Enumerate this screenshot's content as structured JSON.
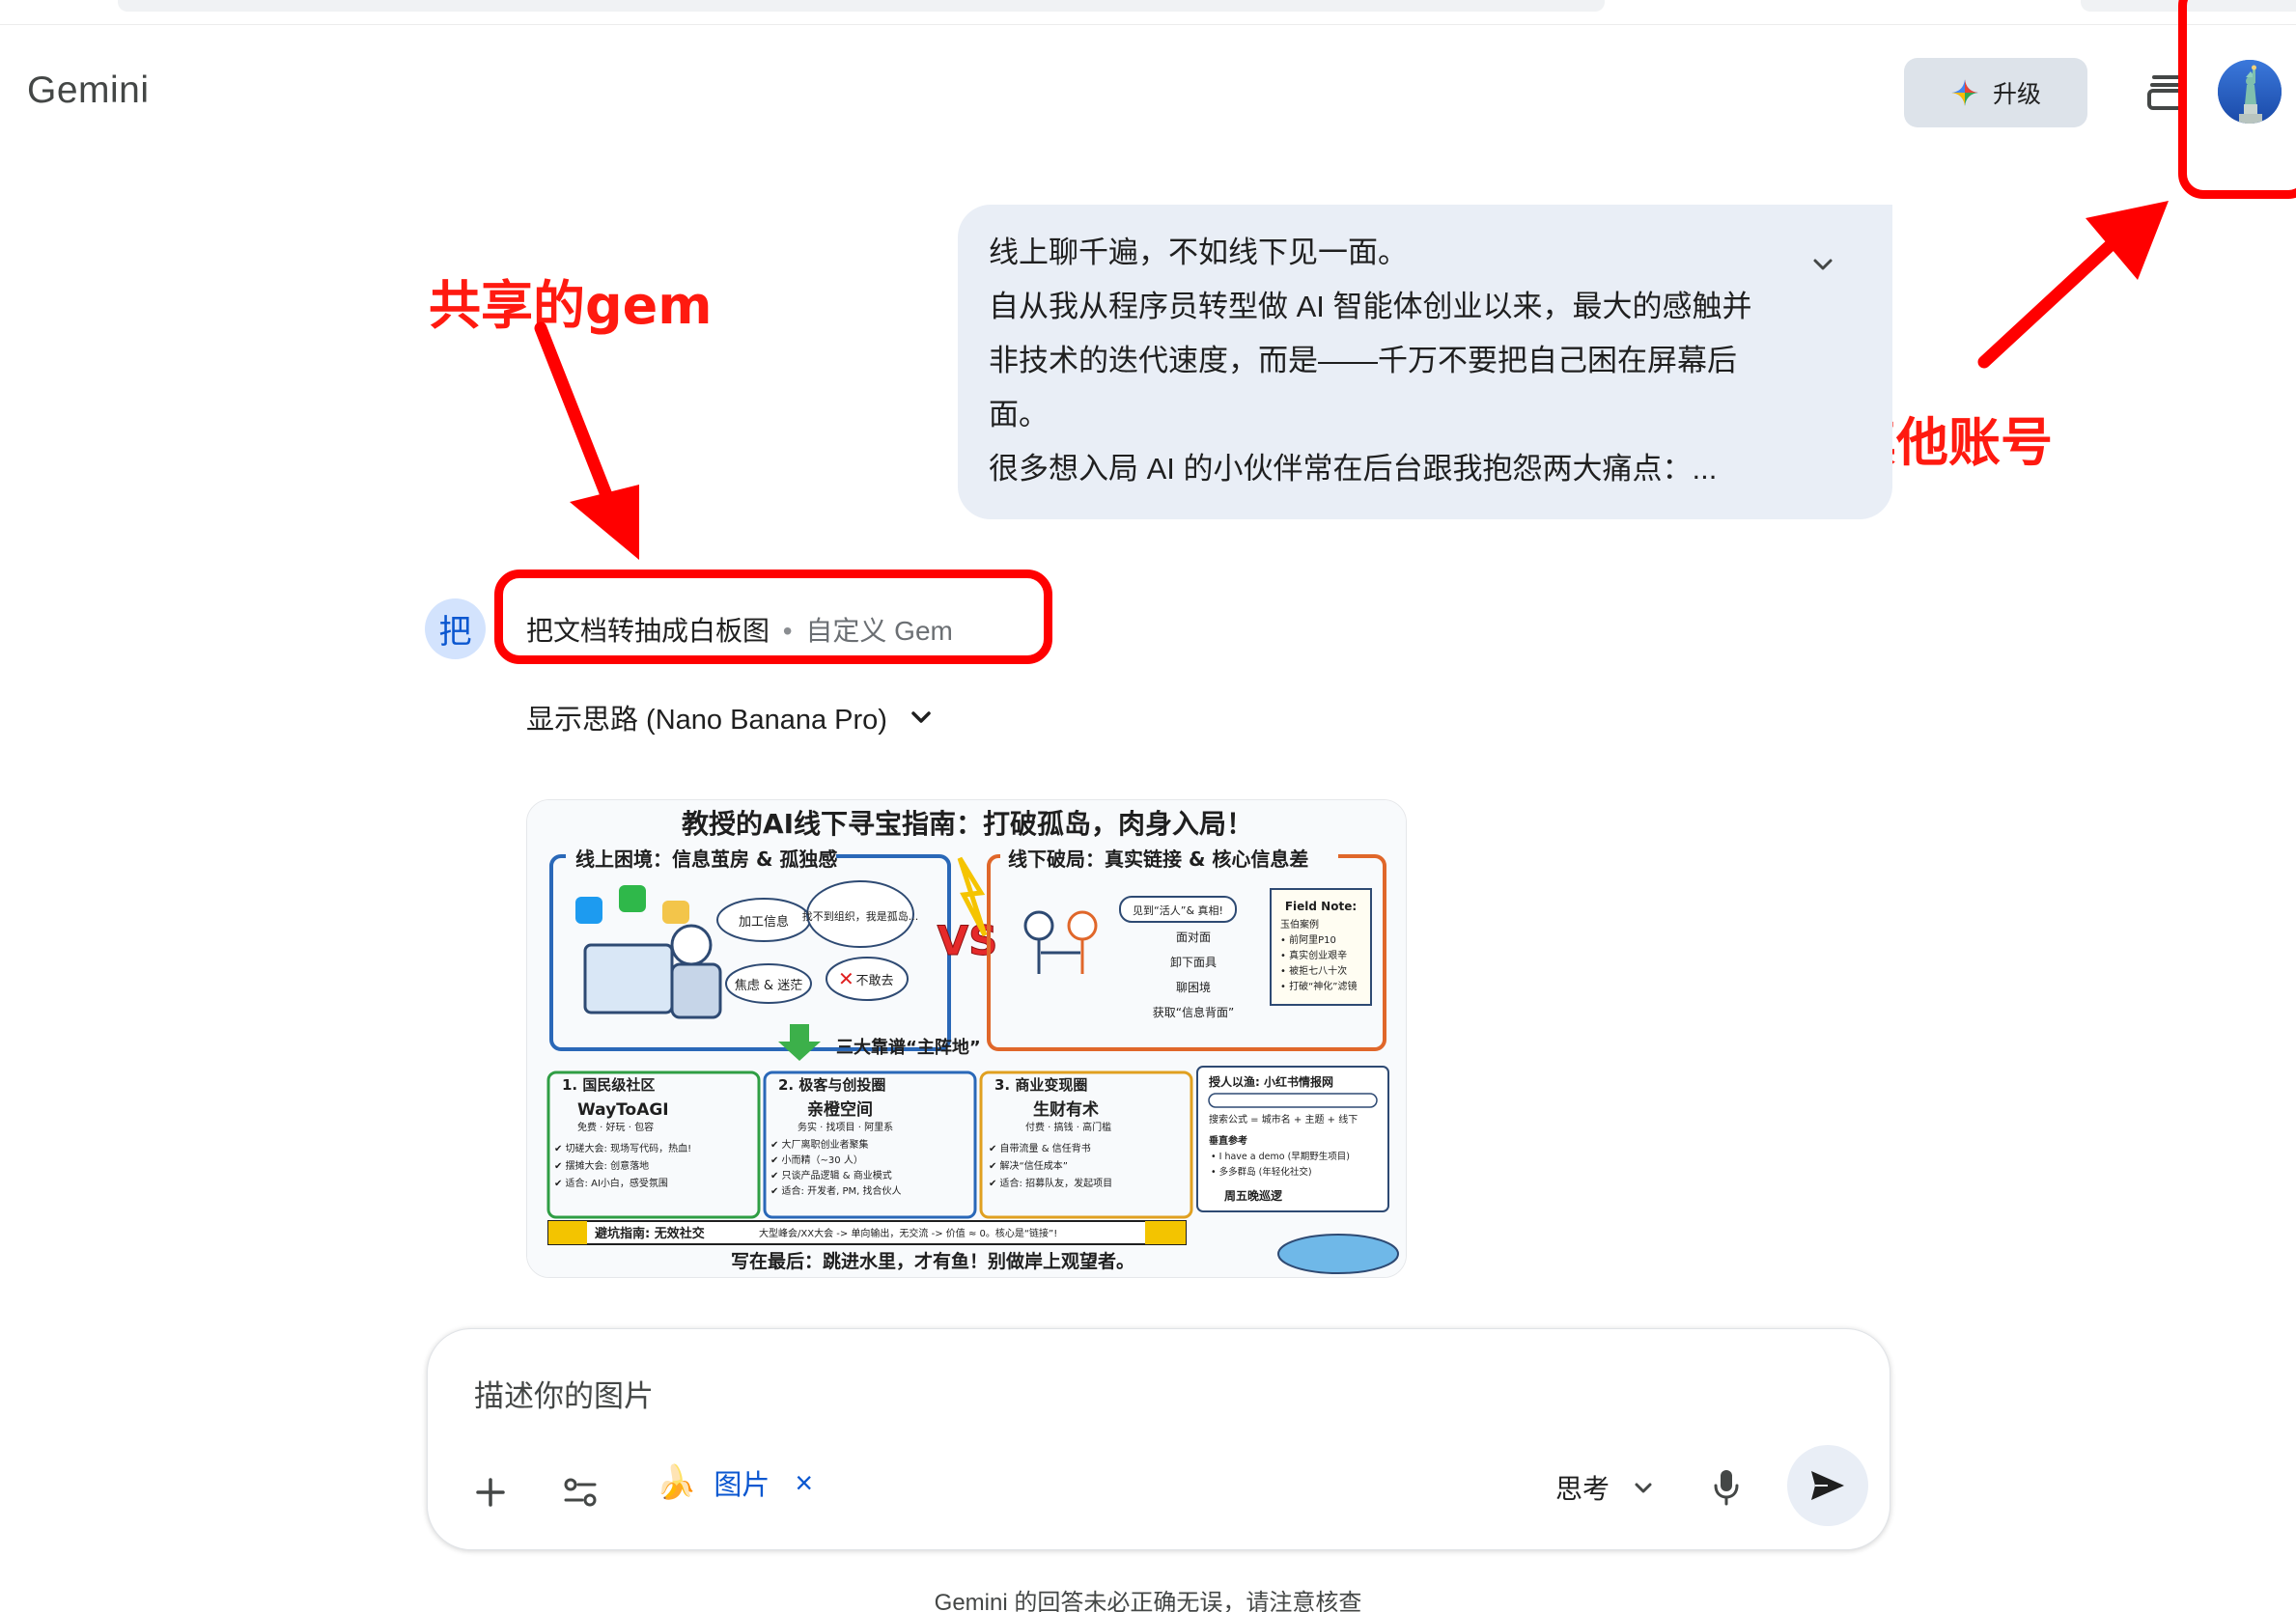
{
  "app": {
    "title": "Gemini"
  },
  "header": {
    "upgrade_label": "升级",
    "upgrade_icon": "sparkle-icon",
    "history_icon": "stack-icon",
    "avatar_icon": "statue-of-liberty-avatar"
  },
  "annotations": {
    "shared_gem": "共享的gem",
    "other_account": "其他账号",
    "color": "#ff0000"
  },
  "user_message": {
    "lines": [
      "线上聊千遍，不如线下见一面。",
      "自从我从程序员转型做 AI 智能体创业以来，最大的感触并",
      "非技术的迭代速度，而是——千万不要把自己困在屏幕后",
      "面。",
      "很多想入局 AI 的小伙伴常在后台跟我抱怨两大痛点：..."
    ],
    "expand_icon": "chevron-down-icon"
  },
  "response": {
    "gem_avatar_char": "把",
    "gem_name": "把文档转抽成白板图",
    "gem_separator": "•",
    "gem_type": "自定义 Gem",
    "thoughts_label": "显示思路 (Nano Banana Pro)"
  },
  "generated_image": {
    "title": "教授的AI线下寻宝指南：打破孤岛，肉身入局！",
    "panel_left_title": "线上困境：信息茧房 & 孤独感",
    "bubble_process": "加工信息",
    "bubble_lost": "找不到组织，我是孤岛...",
    "bubble_anxiety": "焦虑 & 迷茫",
    "bubble_dare": "不敢去",
    "vs": "VS",
    "panel_right_title": "线下破局：真实链接 & 核心信息差",
    "meet": "见到“活人”& 真相!",
    "flow": [
      "面对面",
      "卸下面具",
      "聊困境",
      "获取“信息背面”"
    ],
    "field_note_title": "Field Note:",
    "field_note_lines": [
      "玉伯案例",
      "• 前阿里P10",
      "• 真实创业艰辛",
      "• 被拒七八十次",
      "• 打破“神化”滤镜"
    ],
    "three_bases": "三大靠谱“主阵地”",
    "cards": [
      {
        "title": "1. 国民级社区",
        "name": "WayToAGI",
        "tag": "免费 · 好玩 · 包容",
        "items": [
          "✔ 切磋大会: 现场写代码，热血!",
          "✔ 摆摊大会: 创意落地",
          "✔ 适合: AI小白，感受氛围"
        ]
      },
      {
        "title": "2. 极客与创投圈",
        "name": "亲橙空间",
        "tag": "务实 · 找项目 · 阿里系",
        "items": [
          "✔ 大厂离职创业者聚集",
          "✔ 小而精（~30 人）",
          "✔ 只谈产品逻辑 & 商业模式",
          "✔ 适合: 开发者, PM, 找合伙人"
        ]
      },
      {
        "title": "3. 商业变现圈",
        "name": "生财有术",
        "tag": "付费 · 搞钱 · 高门槛",
        "items": [
          "✔ 自带流量 & 信任背书",
          "✔ 解决“信任成本”",
          "✔ 适合: 招募队友，发起项目"
        ]
      }
    ],
    "fish_title": "授人以渔: 小红书情报网",
    "fish_formula": "搜索公式 = 城市名 + 主题 + 线下",
    "fish_ref": "垂直参考",
    "fish_items": [
      "• I have a demo (早期野生项目)",
      "• 多多群岛 (年轻化社交)"
    ],
    "fish_weekend": "周五晚巡逻",
    "pitfall": "避坑指南: 无效社交",
    "pitfall_text": "大型峰会/XX大会 -> 单向输出，无交流 -> 价值 ≈ 0。核心是“链接”!",
    "footer": "写在最后：跳进水里，才有鱼！别做岸上观望者。"
  },
  "input": {
    "placeholder": "描述你的图片",
    "add_icon": "plus-icon",
    "tools_icon": "tune-icon",
    "chip_icon": "banana-icon",
    "chip_label": "图片",
    "chip_close": "×",
    "mode_label": "思考",
    "mic_icon": "mic-icon",
    "send_icon": "send-icon"
  },
  "disclaimer": "Gemini 的回答未必正确无误，请注意核查"
}
